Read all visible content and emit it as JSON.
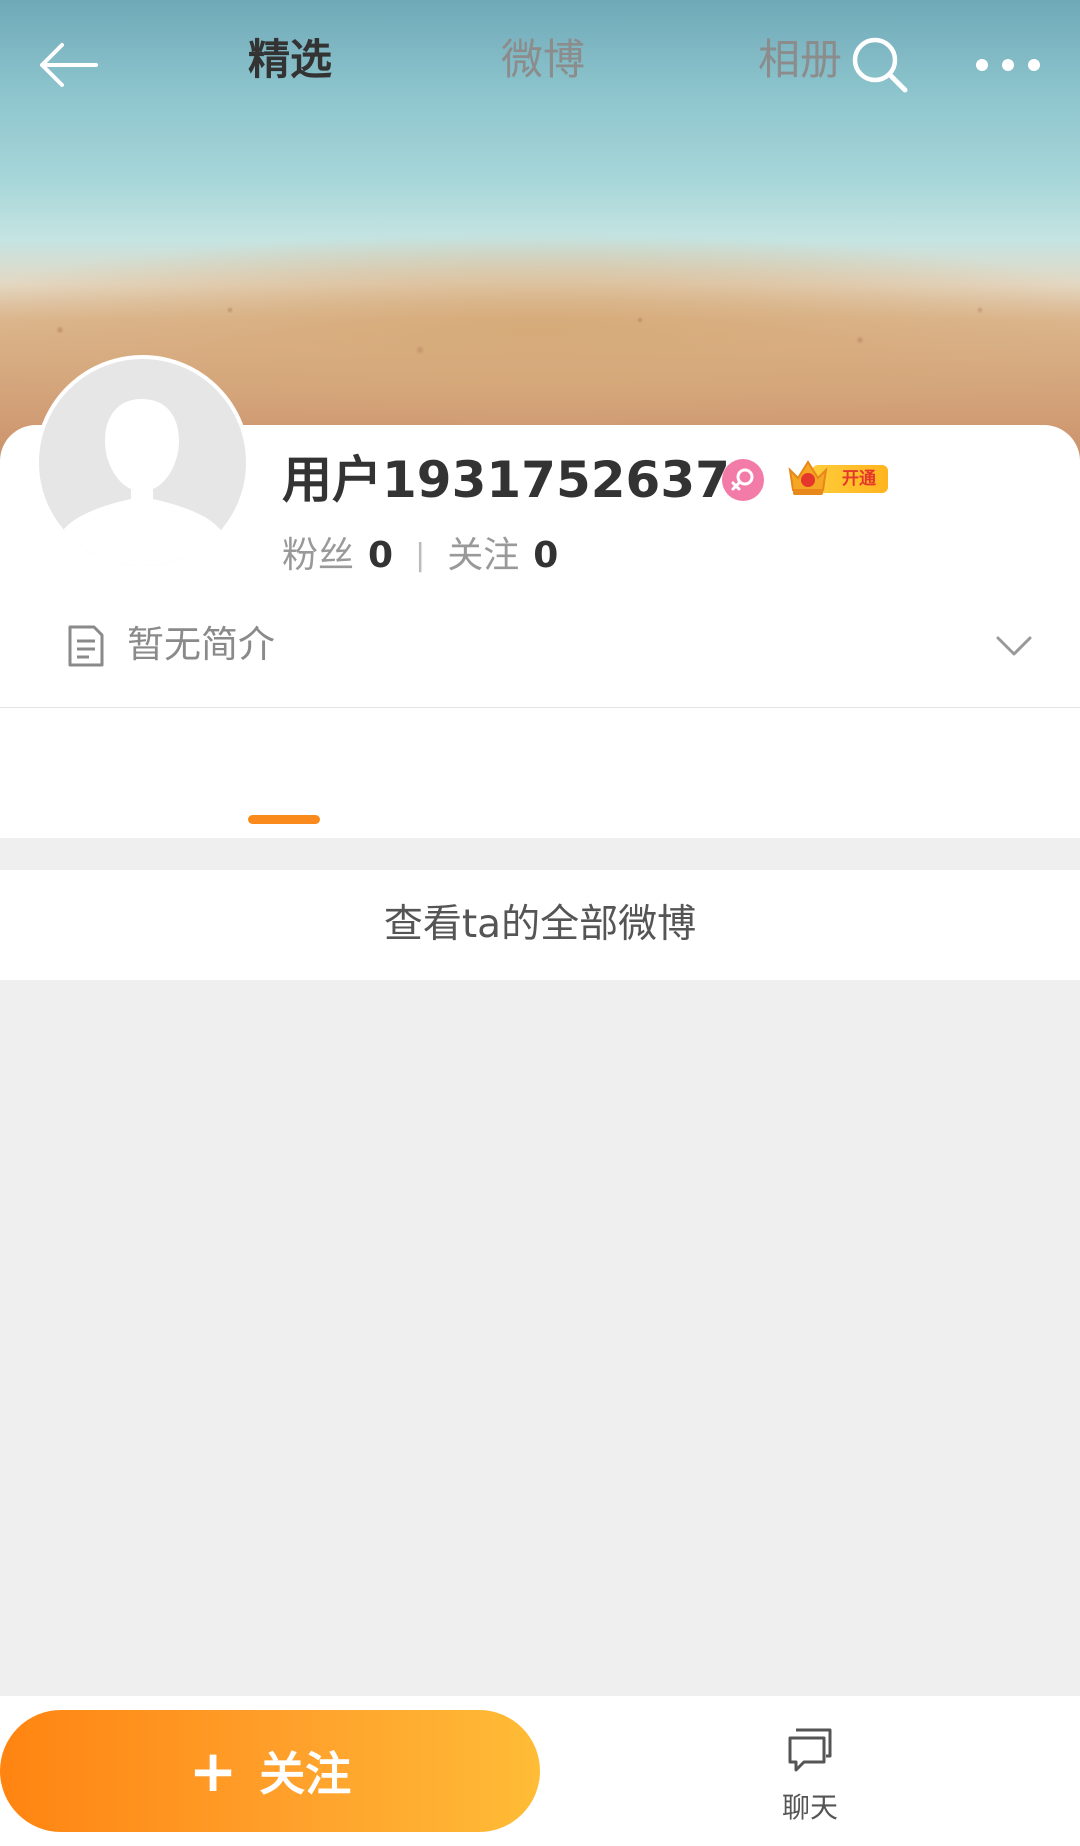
{
  "header": {
    "back_icon": "arrow-left-icon",
    "search_icon": "search-icon",
    "more_icon": "more-dots-icon"
  },
  "profile": {
    "username": "用户1931752637",
    "gender_icon": "female-icon",
    "vip_badge_label": "开通",
    "followers_label": "粉丝",
    "followers_count": "0",
    "separator": "|",
    "following_label": "关注",
    "following_count": "0",
    "bio": "暂无简介"
  },
  "tabs": [
    {
      "label": "精选",
      "active": true
    },
    {
      "label": "微博",
      "active": false
    },
    {
      "label": "相册",
      "active": false
    }
  ],
  "content": {
    "view_all_label": "查看ta的全部微博"
  },
  "bottom_bar": {
    "follow_plus": "+",
    "follow_label": "关注",
    "chat_label": "聊天"
  },
  "colors": {
    "accent": "#fb8a1c",
    "follow_gradient_start": "#ff8411",
    "follow_gradient_end": "#ffbc36",
    "gender_pink": "#f37ba8"
  }
}
